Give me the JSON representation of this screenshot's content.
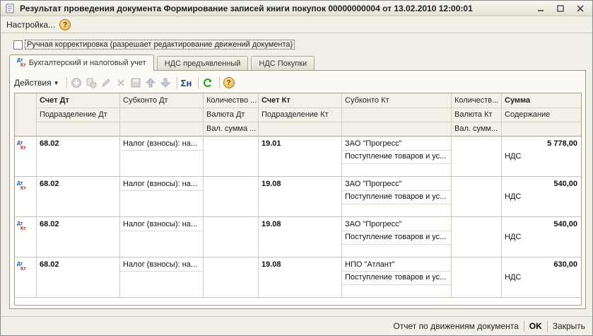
{
  "window": {
    "title": "Результат проведения документа Формирование записей книги покупок 00000000004 от 13.02.2010 12:00:01",
    "buttons": [
      "minimize",
      "maximize",
      "close"
    ]
  },
  "menu": {
    "settings_label": "Настройка...",
    "help_icon": "?"
  },
  "manual_correction": {
    "checked": false,
    "label": "Ручная корректировка (разрешает редактирование движений документа)"
  },
  "tabs": [
    {
      "label": "Бухгалтерский и налоговый учет",
      "active": true
    },
    {
      "label": "НДС предъявленный",
      "active": false
    },
    {
      "label": "НДС Покупки",
      "active": false
    }
  ],
  "toolbar": {
    "actions_label": "Действия",
    "icons": [
      "add-icon",
      "copy-icon",
      "edit-icon",
      "delete-icon",
      "save-icon",
      "move-up-icon",
      "move-down-icon",
      "sum-icon",
      "refresh-icon",
      "help-icon"
    ],
    "help_glyph": "?",
    "sum_glyph": "Σн"
  },
  "grid": {
    "headers": {
      "row1": [
        "Счет Дт",
        "Субконто Дт",
        "Количество ...",
        "Счет Кт",
        "Субконто Кт",
        "Количеств...",
        "Сумма"
      ],
      "row2": [
        "Подразделение Дт",
        "",
        "Валюта Дт",
        "Подразделение Кт",
        "",
        "Валюта Кт",
        "Содержание"
      ],
      "row3": [
        "",
        "",
        "Вал. сумма ...",
        "",
        "",
        "Вал. сумм...",
        ""
      ]
    },
    "row_icon_dt": "Дт",
    "row_icon_kt": "Кт",
    "rows": [
      {
        "account_dt": "68.02",
        "subconto_dt": "Налог (взносы): на...",
        "account_kt": "19.01",
        "subconto_kt_1": "ЗАО \"Прогресс\"",
        "subconto_kt_2": "Поступление товаров и ус...",
        "amount": "5 778,00",
        "content": "НДС"
      },
      {
        "account_dt": "68.02",
        "subconto_dt": "Налог (взносы): на...",
        "account_kt": "19.08",
        "subconto_kt_1": "ЗАО \"Прогресс\"",
        "subconto_kt_2": "Поступление товаров и ус...",
        "amount": "540,00",
        "content": "НДС"
      },
      {
        "account_dt": "68.02",
        "subconto_dt": "Налог (взносы): на...",
        "account_kt": "19.08",
        "subconto_kt_1": "ЗАО \"Прогресс\"",
        "subconto_kt_2": "Поступление товаров и ус...",
        "amount": "540,00",
        "content": "НДС"
      },
      {
        "account_dt": "68.02",
        "subconto_dt": "Налог (взносы): на...",
        "account_kt": "19.08",
        "subconto_kt_1": "НПО \"Атлант\"",
        "subconto_kt_2": "Поступление товаров и ус...",
        "amount": "630,00",
        "content": "НДС"
      }
    ]
  },
  "statusbar": {
    "report_label": "Отчет по движениям документа",
    "ok_label": "OK",
    "close_label": "Закрыть"
  },
  "colors": {
    "dt_blue": "#1a4fb0",
    "kt_red": "#c0201a",
    "window_bg": "#f1efe6"
  }
}
